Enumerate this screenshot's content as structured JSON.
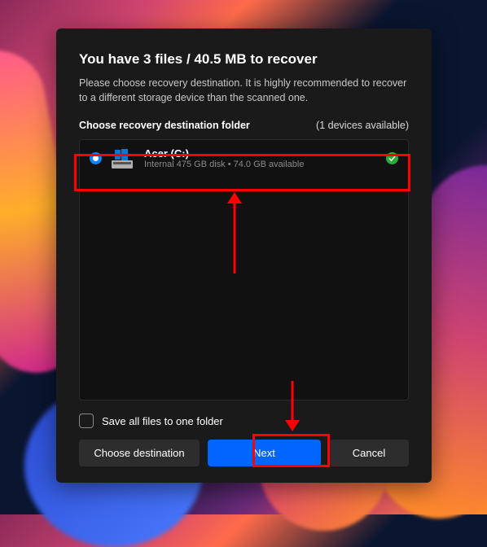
{
  "header": {
    "title": "You have 3 files / 40.5 MB to recover",
    "subtitle": "Please choose recovery destination. It is highly recommended to recover to a different storage device than the scanned one."
  },
  "section": {
    "label": "Choose recovery destination folder",
    "devices_available": "(1 devices available)"
  },
  "drive": {
    "name": "Acer (C:)",
    "details": "Internal 475 GB disk • 74.0 GB available"
  },
  "save_all_label": "Save all files to one folder",
  "buttons": {
    "choose": "Choose destination",
    "next": "Next",
    "cancel": "Cancel"
  }
}
